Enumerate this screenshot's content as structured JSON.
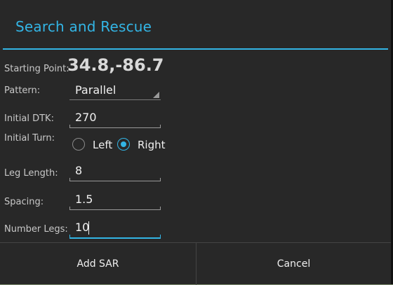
{
  "dialog": {
    "title": "Search and Rescue",
    "accent_color": "#33b5e5"
  },
  "form": {
    "starting_point": {
      "label": "Starting Point:",
      "value": "34.8,-86.7"
    },
    "pattern": {
      "label": "Pattern:",
      "selected": "Parallel"
    },
    "initial_dtk": {
      "label": "Initial DTK:",
      "value": "270"
    },
    "initial_turn": {
      "label": "Initial Turn:",
      "options": [
        {
          "label": "Left",
          "checked": false
        },
        {
          "label": "Right",
          "checked": true
        }
      ]
    },
    "leg_length": {
      "label": "Leg Length:",
      "value": "8"
    },
    "spacing": {
      "label": "Spacing:",
      "value": "1.5"
    },
    "number_legs": {
      "label": "Number Legs:",
      "value": "10"
    }
  },
  "buttons": {
    "add": "Add SAR",
    "cancel": "Cancel"
  }
}
